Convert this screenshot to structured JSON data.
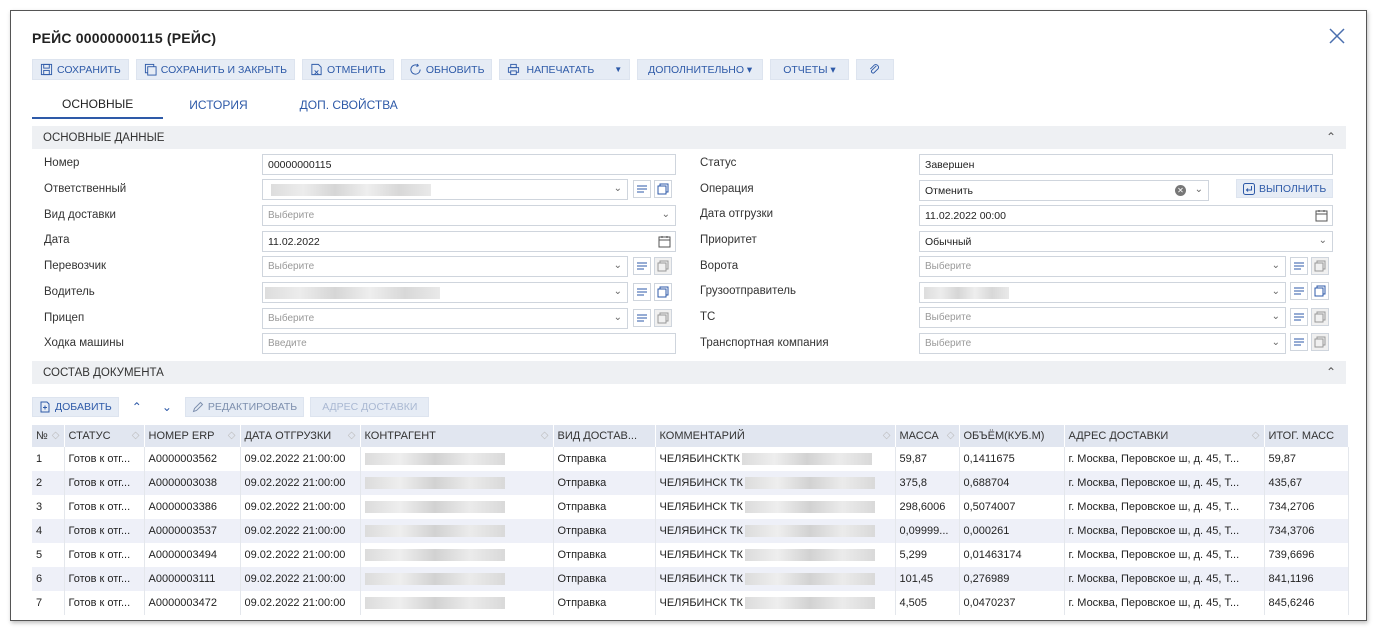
{
  "window": {
    "title": "РЕЙС 00000000115 (РЕЙС)"
  },
  "toolbar": {
    "save": "СОХРАНИТЬ",
    "save_close": "СОХРАНИТЬ И ЗАКРЫТЬ",
    "cancel": "ОТМЕНИТЬ",
    "refresh": "ОБНОВИТЬ",
    "print": "НАПЕЧАТАТЬ",
    "more": "ДОПОЛНИТЕЛЬНО ▾",
    "reports": "ОТЧЕТЫ ▾"
  },
  "tabs": [
    "ОСНОВНЫЕ",
    "ИСТОРИЯ",
    "ДОП. СВОЙСТВА"
  ],
  "main_section": {
    "title": "ОСНОВНЫЕ ДАННЫЕ"
  },
  "left_fields": {
    "number": {
      "label": "Номер",
      "value": "00000000115"
    },
    "responsible": {
      "label": "Ответственный"
    },
    "delivery_type": {
      "label": "Вид доставки",
      "placeholder": "Выберите"
    },
    "date": {
      "label": "Дата",
      "value": "11.02.2022"
    },
    "carrier": {
      "label": "Перевозчик",
      "placeholder": "Выберите"
    },
    "driver": {
      "label": "Водитель"
    },
    "trailer": {
      "label": "Прицеп",
      "placeholder": "Выберите"
    },
    "machine_run": {
      "label": "Ходка машины",
      "placeholder": "Введите"
    }
  },
  "right_fields": {
    "status": {
      "label": "Статус",
      "value": "Завершен"
    },
    "operation": {
      "label": "Операция",
      "value": "Отменить",
      "execute": "ВЫПОЛНИТЬ"
    },
    "ship_date": {
      "label": "Дата отгрузки",
      "value": "11.02.2022 00:00"
    },
    "priority": {
      "label": "Приоритет",
      "value": "Обычный"
    },
    "gate": {
      "label": "Ворота",
      "placeholder": "Выберите"
    },
    "shipper": {
      "label": "Грузоотправитель"
    },
    "vehicle": {
      "label": "ТС",
      "placeholder": "Выберите"
    },
    "transport_company": {
      "label": "Транспортная компания",
      "placeholder": "Выберите"
    }
  },
  "doc_section": {
    "title": "СОСТАВ ДОКУМЕНТА"
  },
  "grid_toolbar": {
    "add": "ДОБАВИТЬ",
    "edit": "РЕДАКТИРОВАТЬ",
    "delivery_address": "АДРЕС ДОСТАВКИ"
  },
  "grid": {
    "columns": [
      "№",
      "СТАТУС",
      "НОМЕР ERP",
      "ДАТА ОТГРУЗКИ",
      "КОНТРАГЕНТ",
      "ВИД ДОСТАВ...",
      "КОММЕНТАРИЙ",
      "МАССА",
      "ОБЪЁМ(КУБ.М)",
      "АДРЕС ДОСТАВКИ",
      "ИТОГ. МАСС"
    ],
    "rows": [
      {
        "n": "1",
        "status": "Готов к отг...",
        "erp": "A0000003562",
        "date": "09.02.2022 21:00:00",
        "dtype": "Отправка",
        "comment": "ЧЕЛЯБИНСКТК",
        "mass": "59,87",
        "vol": "0,1411675",
        "addr": "г. Москва, Перовское ш, д. 45, Т...",
        "total": "59,87"
      },
      {
        "n": "2",
        "status": "Готов к отг...",
        "erp": "A0000003038",
        "date": "09.02.2022 21:00:00",
        "dtype": "Отправка",
        "comment": "ЧЕЛЯБИНСК ТК",
        "mass": "375,8",
        "vol": "0,688704",
        "addr": "г. Москва, Перовское ш, д. 45, Т...",
        "total": "435,67"
      },
      {
        "n": "3",
        "status": "Готов к отг...",
        "erp": "A0000003386",
        "date": "09.02.2022 21:00:00",
        "dtype": "Отправка",
        "comment": "ЧЕЛЯБИНСК ТК",
        "mass": "298,6006",
        "vol": "0,5074007",
        "addr": "г. Москва, Перовское ш, д. 45, Т...",
        "total": "734,2706"
      },
      {
        "n": "4",
        "status": "Готов к отг...",
        "erp": "A0000003537",
        "date": "09.02.2022 21:00:00",
        "dtype": "Отправка",
        "comment": "ЧЕЛЯБИНСК ТК",
        "mass": "0,09999...",
        "vol": "0,000261",
        "addr": "г. Москва, Перовское ш, д. 45, Т...",
        "total": "734,3706"
      },
      {
        "n": "5",
        "status": "Готов к отг...",
        "erp": "A0000003494",
        "date": "09.02.2022 21:00:00",
        "dtype": "Отправка",
        "comment": "ЧЕЛЯБИНСК ТК",
        "mass": "5,299",
        "vol": "0,01463174",
        "addr": "г. Москва, Перовское ш, д. 45, Т...",
        "total": "739,6696"
      },
      {
        "n": "6",
        "status": "Готов к отг...",
        "erp": "A0000003111",
        "date": "09.02.2022 21:00:00",
        "dtype": "Отправка",
        "comment": "ЧЕЛЯБИНСК ТК",
        "mass": "101,45",
        "vol": "0,276989",
        "addr": "г. Москва, Перовское ш, д. 45, Т...",
        "total": "841,1196"
      },
      {
        "n": "7",
        "status": "Готов к отг...",
        "erp": "A0000003472",
        "date": "09.02.2022 21:00:00",
        "dtype": "Отправка",
        "comment": "ЧЕЛЯБИНСК ТК",
        "mass": "4,505",
        "vol": "0,0470237",
        "addr": "г. Москва, Перовское ш, д. 45, Т...",
        "total": "845,6246"
      }
    ]
  }
}
